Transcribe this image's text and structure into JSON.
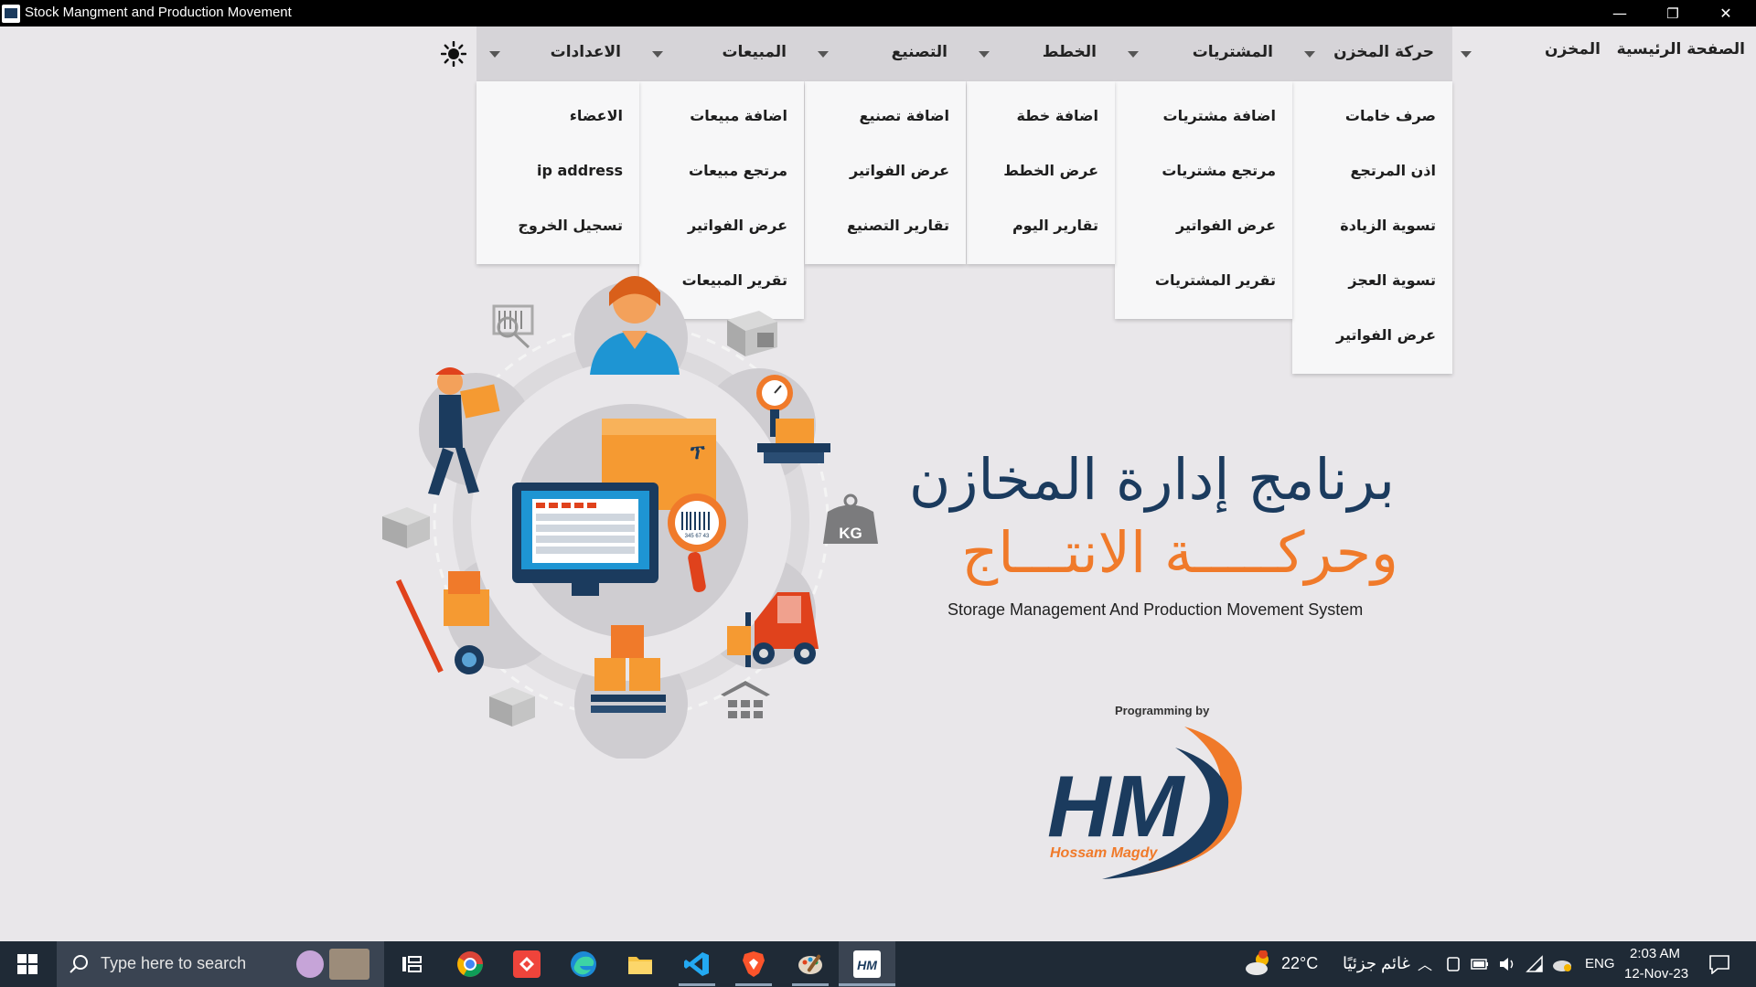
{
  "window": {
    "title": "Stock Mangment and Production Movement",
    "minimize_glyph": "—",
    "restore_glyph": "❐",
    "close_glyph": "✕"
  },
  "menu": {
    "home": "الصفحة الرئيسية",
    "store": "المخزن",
    "stock_movement": {
      "label": "حركة المخزن",
      "items": [
        "صرف خامات",
        "اذن المرتجع",
        "تسوية الزيادة",
        "تسوية العجز",
        "عرض الفواتير"
      ]
    },
    "purchases": {
      "label": "المشتريات",
      "items": [
        "اضافة مشتريات",
        "مرتجع مشتريات",
        "عرض الفواتير",
        "تقرير المشتريات"
      ]
    },
    "plans": {
      "label": "الخطط",
      "items": [
        "اضافة خطة",
        "عرض الخطط",
        "تقارير اليوم"
      ]
    },
    "manufacturing": {
      "label": "التصنيع",
      "items": [
        "اضافة تصنيع",
        "عرض الفواتير",
        "تقارير التصنيع"
      ]
    },
    "sales": {
      "label": "المبيعات",
      "items": [
        "اضافة مبيعات",
        "مرتجع مبيعات",
        "عرض الفواتير",
        "تقرير المبيعات"
      ]
    },
    "settings": {
      "label": "الاعدادات",
      "items": [
        "الاعضاء",
        "ip address",
        "تسجيل الخروج"
      ]
    },
    "theme_icon": "sun-icon"
  },
  "hero": {
    "title_line1": "برنامج إدارة المخازن",
    "title_line2": "وحركـــــة الانتـــاج",
    "subtitle": "Storage Management And Production Movement System",
    "programming_by": "Programming by",
    "logo_letters": "HM",
    "logo_name": "Hossam Magdy",
    "colors": {
      "navy": "#1b3b5e",
      "orange": "#f07a2a"
    }
  },
  "illustration": {
    "monitor_barcode_number": "345 67 43",
    "kg_label": "KG"
  },
  "taskbar": {
    "search_placeholder": "Type here to search",
    "weather_temp": "22°C",
    "weather_desc": "غائم جزئيًا",
    "language": "ENG",
    "time": "2:03 AM",
    "date": "12-Nov-23"
  }
}
